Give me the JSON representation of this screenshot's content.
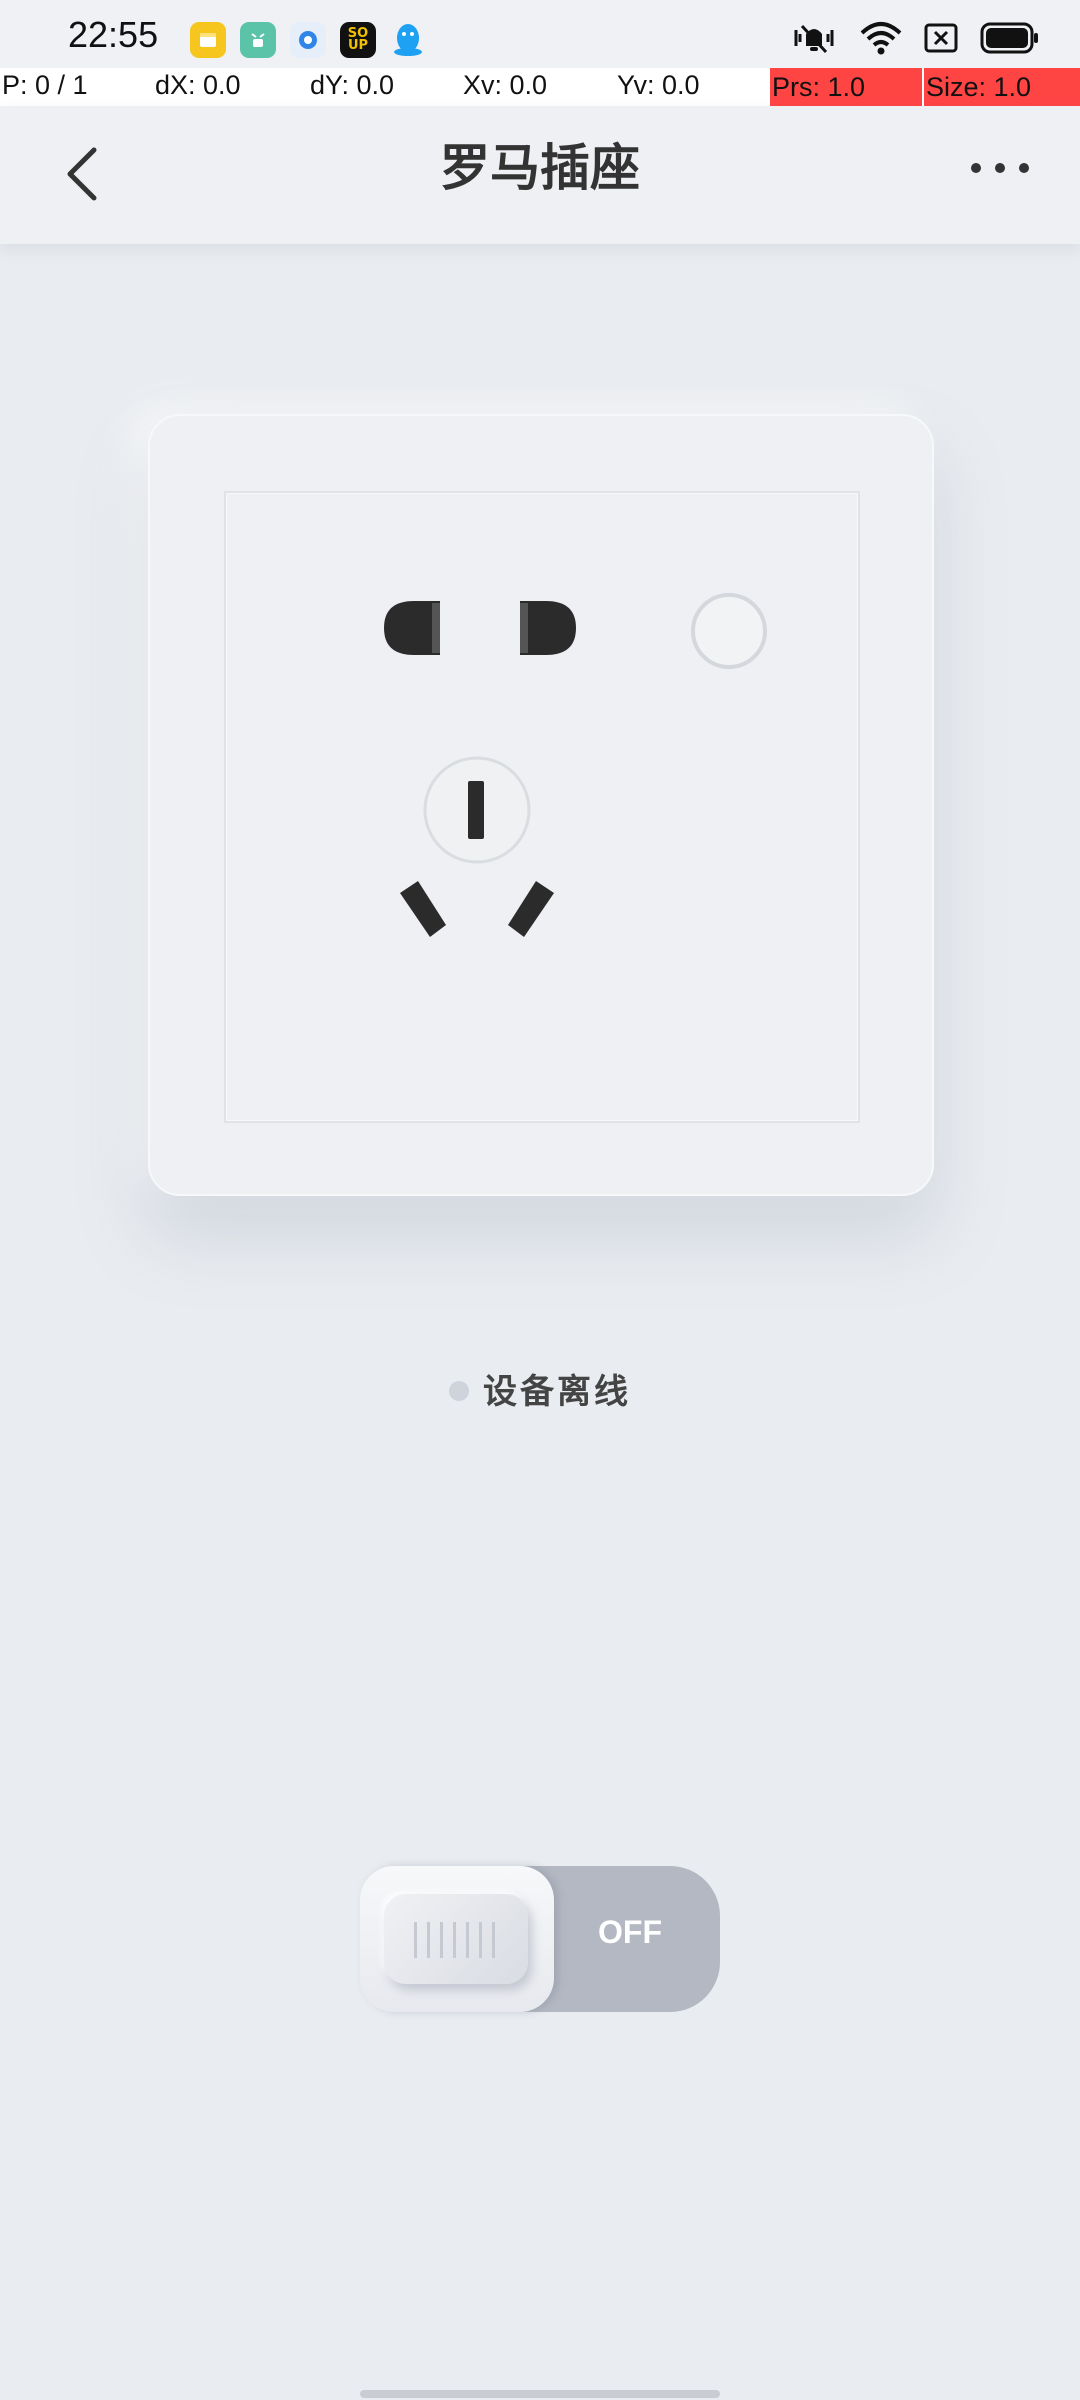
{
  "status_bar": {
    "time": "22:55",
    "app_icons": [
      "files-icon",
      "robot-icon",
      "circle-app-icon",
      "soul-app-icon",
      "qq-penguin-icon"
    ],
    "soul_label": "SO UP",
    "system_icons": [
      "vibrate-mute-icon",
      "wifi-icon",
      "sim-x-icon",
      "battery-icon"
    ]
  },
  "debug_overlay": {
    "pointer": "P: 0 / 1",
    "dx": "dX: 0.0",
    "dy": "dY: 0.0",
    "xv": "Xv: 0.0",
    "yv": "Yv: 0.0",
    "prs": "Prs: 1.0",
    "size": "Size: 1.0"
  },
  "header": {
    "title": "罗马插座",
    "back_icon": "chevron-left-icon",
    "more_icon": "more-horizontal-icon"
  },
  "device": {
    "status_text": "设备离线",
    "status_color": "#cfd3db"
  },
  "toggle": {
    "state_label": "OFF",
    "is_on": false,
    "track_color": "#b3b8c2"
  }
}
